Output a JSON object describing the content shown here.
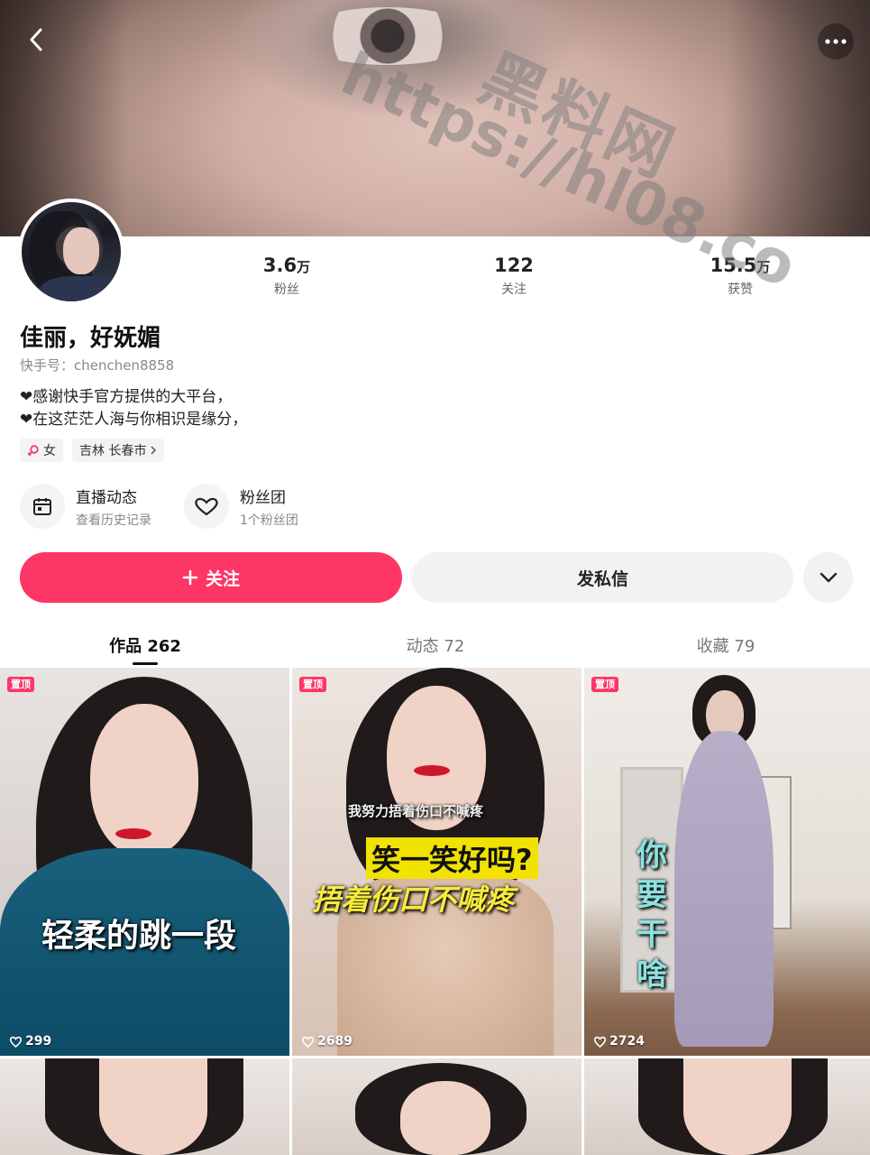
{
  "watermark": {
    "name": "黑料网",
    "url": "https://hl08.co"
  },
  "profile": {
    "name": "佳丽，好妩媚",
    "uid_label": "快手号：chenchen8858",
    "bio_lines": [
      "❤感谢快手官方提供的大平台，",
      "❤在这茫茫人海与你相识是缘分，"
    ],
    "gender_tag": "女",
    "location_tag": "吉林 长春市"
  },
  "stats": [
    {
      "num": "3.6",
      "unit": "万",
      "label": "粉丝"
    },
    {
      "num": "122",
      "unit": "",
      "label": "关注"
    },
    {
      "num": "15.5",
      "unit": "万",
      "label": "获赞"
    }
  ],
  "quick": {
    "live": {
      "title": "直播动态",
      "sub": "查看历史记录"
    },
    "fans": {
      "title": "粉丝团",
      "sub": "1个粉丝团"
    }
  },
  "buttons": {
    "follow": "关注",
    "message": "发私信"
  },
  "tabs": [
    {
      "label": "作品 262"
    },
    {
      "label": "动态 72"
    },
    {
      "label": "收藏 79"
    }
  ],
  "videos": [
    {
      "pin": "置顶",
      "likes": "299",
      "caption": "轻柔的跳一段"
    },
    {
      "pin": "置顶",
      "likes": "2689",
      "caption_small": "我努力捂着伤口不喊疼",
      "caption_main": "笑一笑好吗?",
      "caption_sub": "捂着伤口不喊疼"
    },
    {
      "pin": "置顶",
      "likes": "2724",
      "caption": "你要干啥"
    }
  ],
  "colors": {
    "accent": "#fe3666",
    "button_gray": "#f2f2f2"
  }
}
